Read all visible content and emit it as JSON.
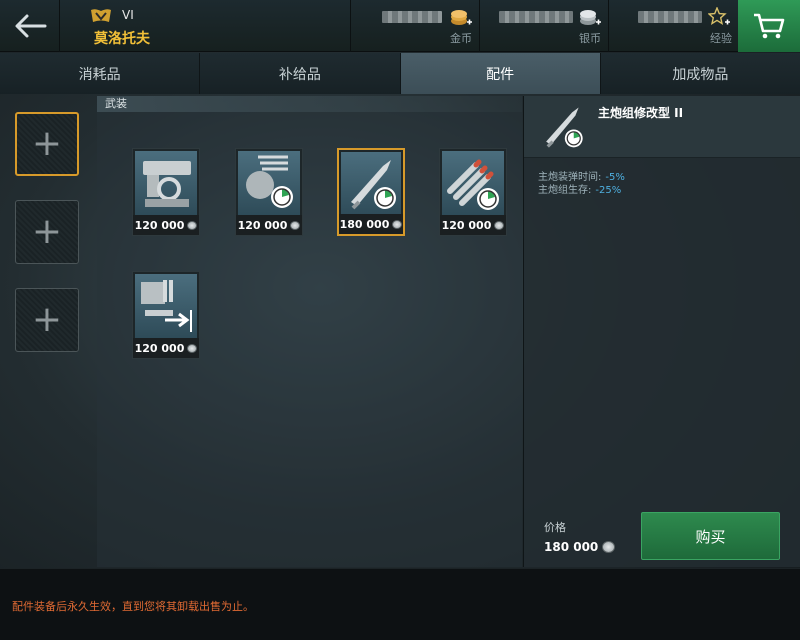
{
  "header": {
    "tier": "VI",
    "ship_name": "莫洛托夫",
    "gold_label": "金币",
    "credits_label": "银币",
    "exp_label": "经验",
    "icons": [
      "back-arrow-icon",
      "rank-badge-icon",
      "gold-coin-icon",
      "silver-coin-icon",
      "star-icon",
      "cart-icon"
    ],
    "colors": {
      "accent": "#f2c038",
      "cart": "#2f9a57"
    }
  },
  "tabs": [
    {
      "label": "消耗品",
      "active": false
    },
    {
      "label": "补给品",
      "active": false
    },
    {
      "label": "配件",
      "active": true
    },
    {
      "label": "加成物品",
      "active": false
    }
  ],
  "slots": [
    {
      "symbol": "+",
      "selected": true
    },
    {
      "symbol": "+",
      "selected": false
    },
    {
      "symbol": "+",
      "selected": false
    }
  ],
  "section": {
    "label": "武装"
  },
  "items": [
    {
      "icon": "gun-mount-icon",
      "price": "120 000",
      "selected": false
    },
    {
      "icon": "turret-timer-icon",
      "price": "120 000",
      "selected": false
    },
    {
      "icon": "shell-timer-icon",
      "price": "180 000",
      "selected": true
    },
    {
      "icon": "torpedo-timer-icon",
      "price": "120 000",
      "selected": false
    },
    {
      "icon": "secondary-guns-icon",
      "price": "120 000",
      "selected": false
    }
  ],
  "detail": {
    "name": "主炮组修改型 II",
    "stats": [
      {
        "label": "主炮装弹时间:",
        "value": "-5%"
      },
      {
        "label": "主炮组生存:",
        "value": "-25%"
      }
    ],
    "price_label": "价格",
    "price_value": "180 000",
    "buy_label": "购买"
  },
  "footer": {
    "note": "配件装备后永久生效，直到您将其卸载出售为止。"
  }
}
